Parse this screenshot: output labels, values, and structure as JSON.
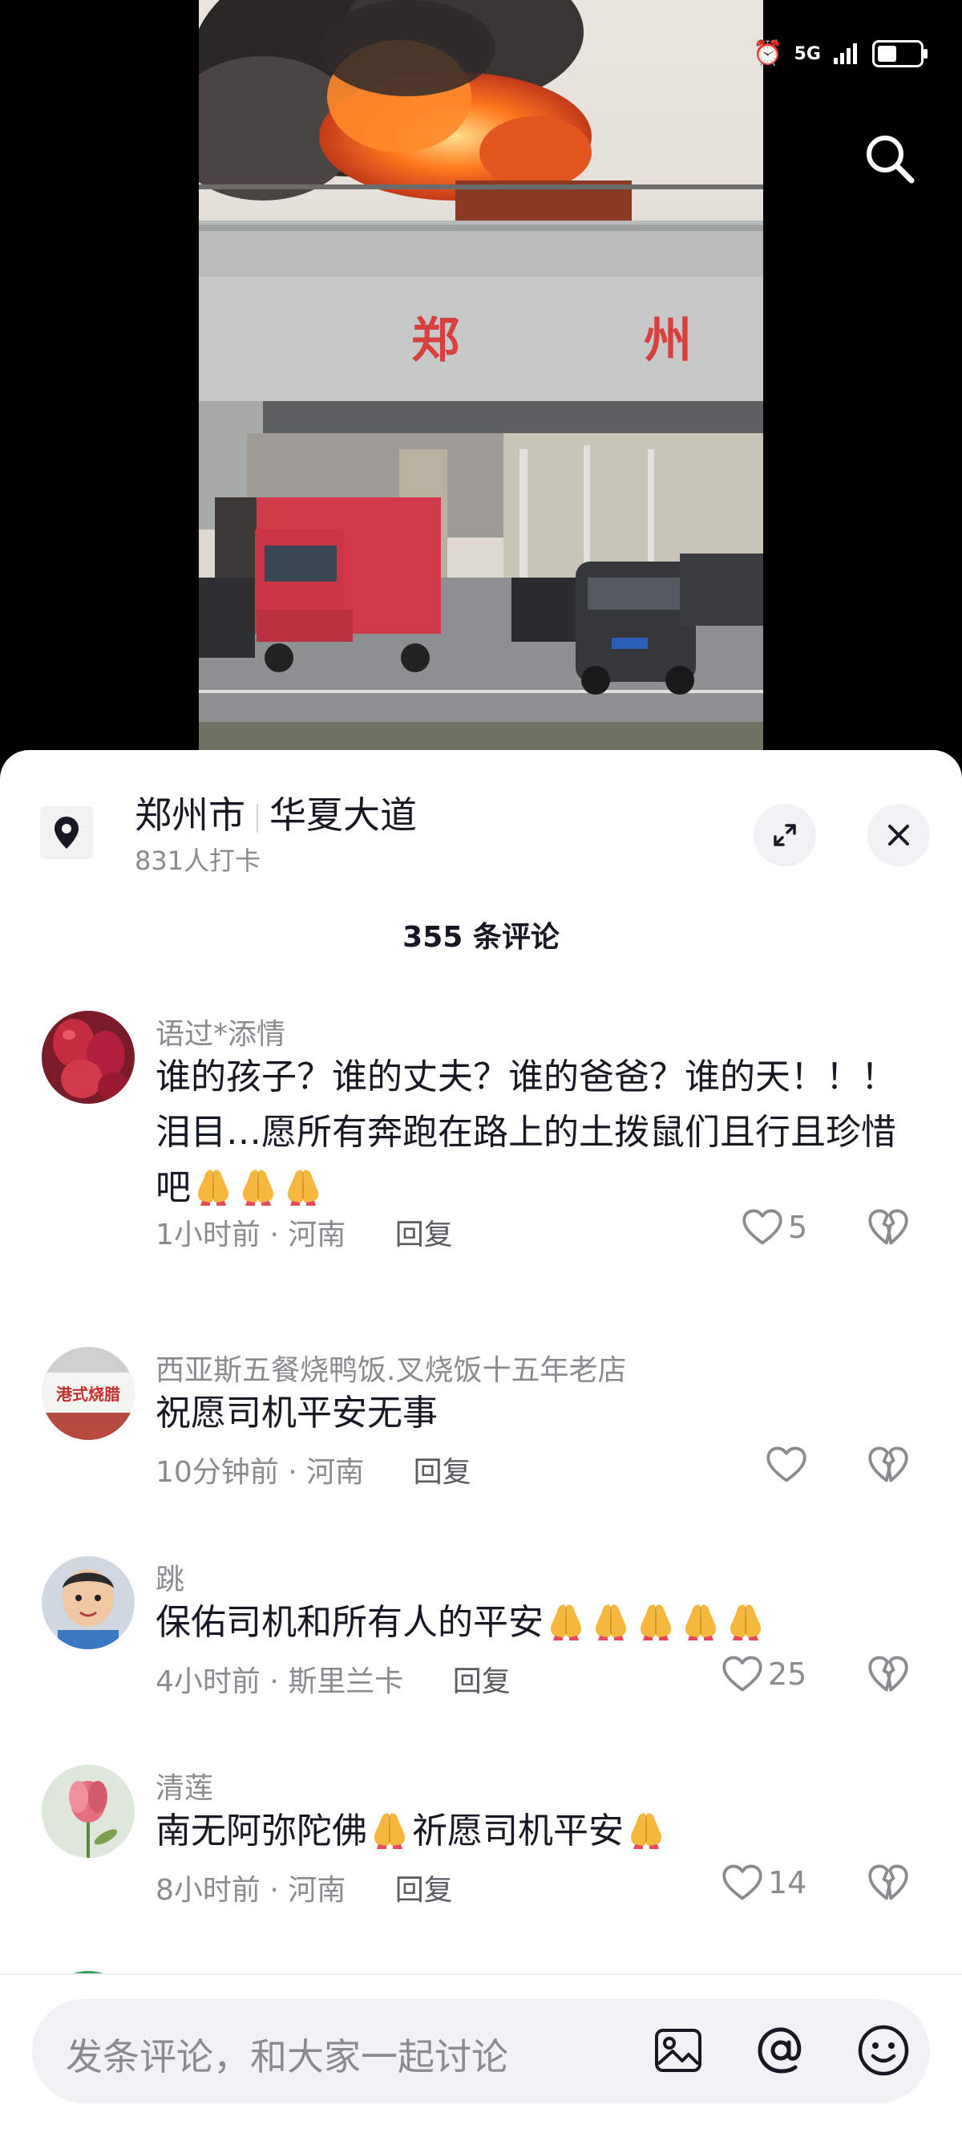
{
  "video": {
    "scene_text": "郑 州"
  },
  "status_bar": {
    "alarm_icon": "alarm-clock-icon",
    "network": "5G",
    "battery_level": 0.45
  },
  "location": {
    "city": "郑州市",
    "road": "华夏大道",
    "checkins": "831人打卡"
  },
  "comments_header": "355 条评论",
  "comments": [
    {
      "user": "语过*添情",
      "text_1": "谁的孩子？谁的丈夫？谁的爸爸？谁的天！！！泪目…愿所有奔跑在路上的土拨鼠们且行且珍惜吧",
      "emoji_count": 3,
      "time": "1小时前",
      "region": "河南",
      "reply": "回复",
      "likes": "5"
    },
    {
      "user": "西亚斯五餐烧鸭饭.叉烧饭十五年老店",
      "avatar_text": "港式烧腊",
      "text_1": "祝愿司机平安无事",
      "time": "10分钟前",
      "region": "河南",
      "reply": "回复",
      "likes": ""
    },
    {
      "user": "跳",
      "text_1": "保佑司机和所有人的平安",
      "emoji_count": 5,
      "time": "4小时前",
      "region": "斯里兰卡",
      "reply": "回复",
      "likes": "25"
    },
    {
      "user": "清莲",
      "text_1": "南无阿弥陀佛",
      "text_2": "祈愿司机平安",
      "time": "8小时前",
      "region": "河南",
      "reply": "回复",
      "likes": "14"
    }
  ],
  "meta_separator": "·",
  "input": {
    "placeholder": "发条评论，和大家一起讨论"
  },
  "icons": {
    "search": "search-icon",
    "pin": "location-pin-icon",
    "expand": "expand-icon",
    "close": "close-icon",
    "like": "heart-icon",
    "dislike": "broken-heart-icon",
    "image": "image-icon",
    "mention": "at-icon",
    "emoji": "emoji-icon",
    "pray": "pray-emoji-icon"
  },
  "colors": {
    "text_primary": "#161823",
    "text_secondary": "#8a8a8f",
    "sheet_bg": "#ffffff",
    "input_bg": "#f2f2f4"
  }
}
